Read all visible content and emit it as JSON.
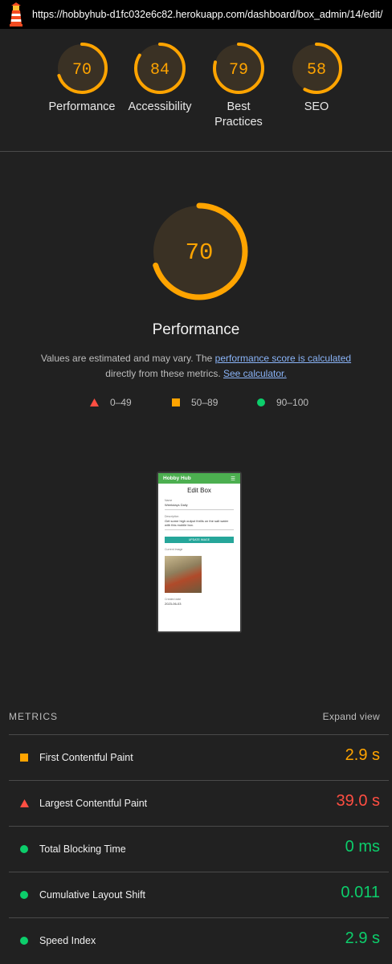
{
  "browser": {
    "url": "https://hobbyhub-d1fc032e6c82.herokuapp.com/dashboard/box_admin/14/edit/"
  },
  "colors": {
    "pass": "#0cce6b",
    "average": "#ffa400",
    "fail": "#ff4e42",
    "gauge_fill_average": "#3a3124"
  },
  "gauges": [
    {
      "score": "70",
      "fraction": 0.7,
      "label": "Performance"
    },
    {
      "score": "84",
      "fraction": 0.84,
      "label": "Accessibility"
    },
    {
      "score": "79",
      "fraction": 0.79,
      "label": "Best Practices"
    },
    {
      "score": "58",
      "fraction": 0.58,
      "label": "SEO"
    }
  ],
  "performance": {
    "score": "70",
    "fraction": 0.7,
    "title": "Performance",
    "desc_prefix": "Values are estimated and may vary. The ",
    "desc_link": "performance score is calculated",
    "desc_middle": " directly from these metrics. ",
    "desc_link2": "See calculator."
  },
  "legend": [
    {
      "shape": "triangle",
      "range": "0–49"
    },
    {
      "shape": "square",
      "range": "50–89"
    },
    {
      "shape": "circle",
      "range": "90–100"
    }
  ],
  "screenshot": {
    "brand": "Hobby Hub",
    "menu_icon": "hamburger-icon",
    "heading": "Edit Box",
    "field1_label": "Name",
    "field1_value": "Weekdays Daily",
    "field2_label": "Description",
    "field2_value": "Get some high output thrills on the salt water with this mobile box.",
    "button": "UPDATE IMAGE",
    "image_label": "Current Image",
    "date_label": "Created date",
    "date_value": "2023-06-03"
  },
  "metrics": {
    "heading": "METRICS",
    "expand": "Expand view",
    "items": [
      {
        "name": "First Contentful Paint",
        "value": "2.9 s",
        "rating": "average"
      },
      {
        "name": "Largest Contentful Paint",
        "value": "39.0 s",
        "rating": "fail"
      },
      {
        "name": "Total Blocking Time",
        "value": "0 ms",
        "rating": "pass"
      },
      {
        "name": "Cumulative Layout Shift",
        "value": "0.011",
        "rating": "pass"
      },
      {
        "name": "Speed Index",
        "value": "2.9 s",
        "rating": "pass"
      }
    ]
  }
}
